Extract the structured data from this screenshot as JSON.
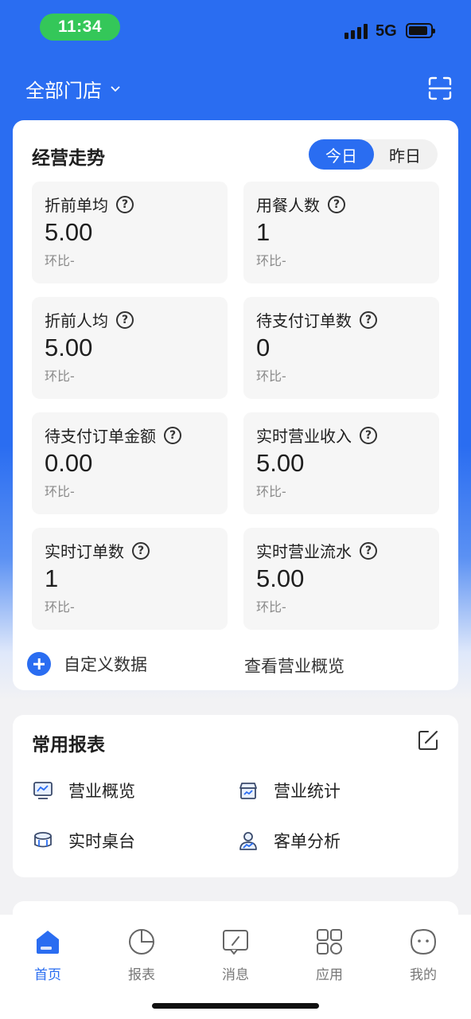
{
  "status_bar": {
    "time": "11:34",
    "network": "5G"
  },
  "header": {
    "store_selector": "全部门店"
  },
  "trend": {
    "title": "经营走势",
    "toggle": {
      "today": "今日",
      "yesterday": "昨日",
      "selected": "today"
    },
    "metrics": [
      {
        "label": "折前单均",
        "value": "5.00",
        "compare": "环比-"
      },
      {
        "label": "用餐人数",
        "value": "1",
        "compare": "环比-"
      },
      {
        "label": "折前人均",
        "value": "5.00",
        "compare": "环比-"
      },
      {
        "label": "待支付订单数",
        "value": "0",
        "compare": "环比-"
      },
      {
        "label": "待支付订单金额",
        "value": "0.00",
        "compare": "环比-"
      },
      {
        "label": "实时营业收入",
        "value": "5.00",
        "compare": "环比-"
      },
      {
        "label": "实时订单数",
        "value": "1",
        "compare": "环比-"
      },
      {
        "label": "实时营业流水",
        "value": "5.00",
        "compare": "环比-"
      }
    ],
    "custom_data": "自定义数据",
    "view_overview": "查看营业概览"
  },
  "reports": {
    "title": "常用报表",
    "items": [
      {
        "label": "营业概览",
        "icon": "monitor-chart-icon"
      },
      {
        "label": "营业统计",
        "icon": "store-icon"
      },
      {
        "label": "实时桌台",
        "icon": "table-icon"
      },
      {
        "label": "客单分析",
        "icon": "person-chart-icon"
      }
    ]
  },
  "tabbar": {
    "items": [
      {
        "label": "首页",
        "icon": "home-icon",
        "active": true
      },
      {
        "label": "报表",
        "icon": "pie-chart-icon",
        "active": false
      },
      {
        "label": "消息",
        "icon": "message-icon",
        "active": false
      },
      {
        "label": "应用",
        "icon": "apps-icon",
        "active": false
      },
      {
        "label": "我的",
        "icon": "profile-icon",
        "active": false
      }
    ]
  },
  "colors": {
    "primary": "#2a6df1",
    "status_green": "#34c759"
  }
}
